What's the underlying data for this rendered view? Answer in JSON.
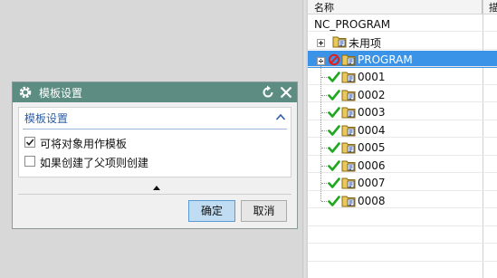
{
  "dialog": {
    "title": "模板设置",
    "group_title": "模板设置",
    "options": [
      {
        "label": "可将对象用作模板",
        "checked": true
      },
      {
        "label": "如果创建了父项则创建",
        "checked": false
      }
    ],
    "ok_label": "确定",
    "cancel_label": "取消"
  },
  "tree": {
    "col_name": "名称",
    "col_second": "描",
    "root": "NC_PROGRAM",
    "nodes": [
      {
        "label": "未用项",
        "status": "none",
        "selected": false
      },
      {
        "label": "PROGRAM",
        "status": "blocked",
        "selected": true
      },
      {
        "label": "0001",
        "status": "ok",
        "selected": false
      },
      {
        "label": "0002",
        "status": "ok",
        "selected": false
      },
      {
        "label": "0003",
        "status": "ok",
        "selected": false
      },
      {
        "label": "0004",
        "status": "ok",
        "selected": false
      },
      {
        "label": "0005",
        "status": "ok",
        "selected": false
      },
      {
        "label": "0006",
        "status": "ok",
        "selected": false
      },
      {
        "label": "0007",
        "status": "ok",
        "selected": false
      },
      {
        "label": "0008",
        "status": "ok",
        "selected": false
      }
    ]
  },
  "icons": {
    "title_gear": "gear-icon",
    "title_reset": "reset-icon",
    "title_close": "close-icon",
    "group_collapse": "chevron-up-icon",
    "dialog_expand": "triangle-up-icon",
    "folder": "program-folder-icon",
    "status_ok": "check-icon",
    "status_blocked": "no-entry-icon",
    "expand": "plus-expander-icon"
  },
  "colors": {
    "title_bar": "#5d8c82",
    "group_title": "#2e5fa6",
    "selection": "#3a93e6",
    "check": "#1fa81f",
    "blocked": "#e0201c"
  }
}
